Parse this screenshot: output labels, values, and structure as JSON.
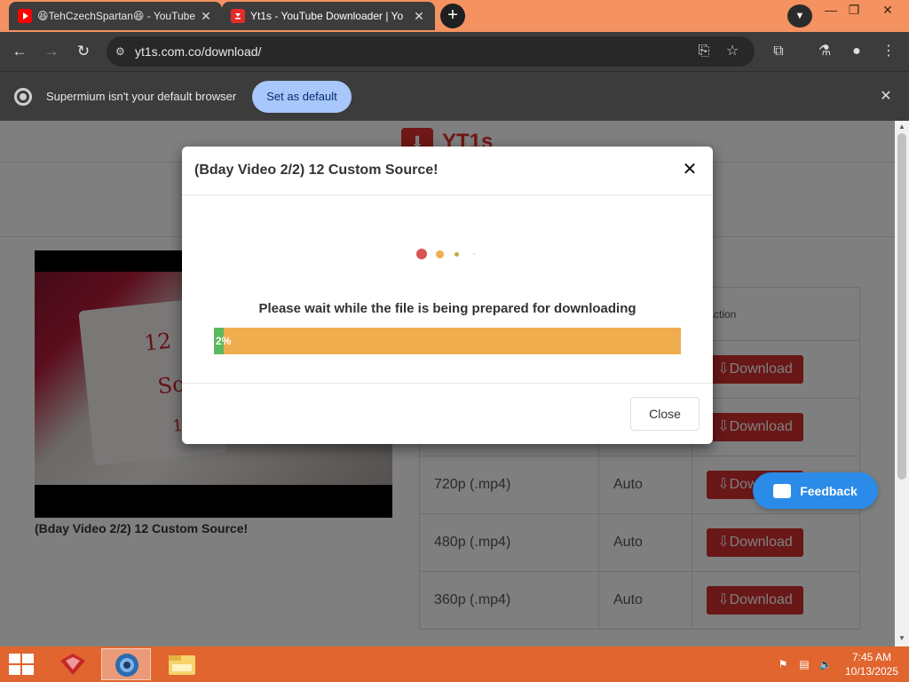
{
  "browser": {
    "tabs": [
      {
        "title": "😆TehCzechSpartan😆 - YouTube",
        "icon": "youtube-icon"
      },
      {
        "title": "Yt1s - YouTube Downloader | Yo",
        "icon": "yt1s-icon",
        "active": true
      }
    ],
    "new_tab_label": "+",
    "url": "yt1s.com.co/download/",
    "infobar": {
      "message": "Supermium isn't your default browser",
      "button": "Set as default"
    }
  },
  "page": {
    "logo_text": "YT1s",
    "video_title": "(Bday Video 2/2) 12 Custom Source!",
    "table": {
      "header_action": "Action",
      "rows": [
        {
          "quality": "",
          "size": "",
          "action": "Download"
        },
        {
          "quality": "",
          "size": "",
          "action": "Download"
        },
        {
          "quality": "720p (.mp4)",
          "size": "Auto",
          "action": "Download"
        },
        {
          "quality": "480p (.mp4)",
          "size": "Auto",
          "action": "Download"
        },
        {
          "quality": "360p (.mp4)",
          "size": "Auto",
          "action": "Download"
        }
      ]
    },
    "feedback_label": "Feedback"
  },
  "modal": {
    "title": "(Bday Video 2/2) 12 Custom Source!",
    "message": "Please wait while the file is being prepared for downloading",
    "progress_percent": 2,
    "progress_label": "2%",
    "close_label": "Close"
  },
  "taskbar": {
    "time": "7:45 AM",
    "date": "10/13/2025"
  },
  "colors": {
    "tabstrip": "#f49261",
    "accent_red": "#d32f2f",
    "progress_bg": "#f0ad4e",
    "progress_fill": "#5cb85c",
    "feedback_blue": "#2b8be8",
    "taskbar": "#e0652e"
  }
}
